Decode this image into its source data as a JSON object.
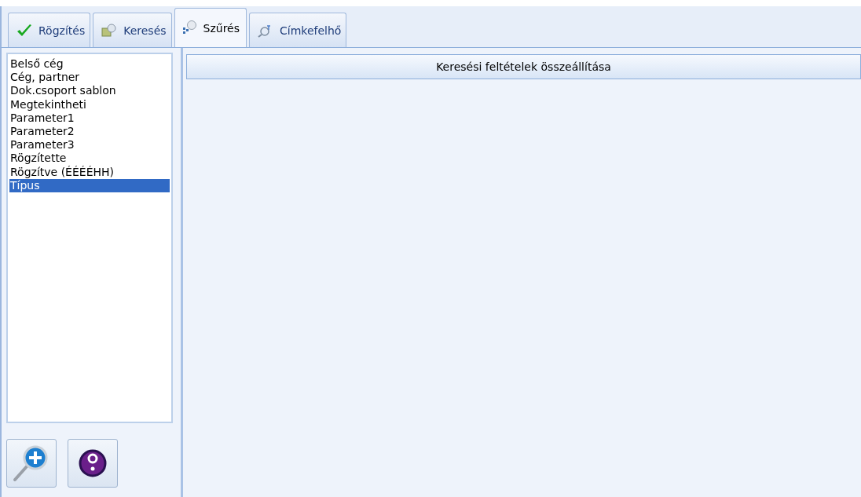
{
  "tabs": [
    {
      "label": "Rögzítés",
      "kind": "check",
      "selected": false
    },
    {
      "label": "Keresés",
      "kind": "search",
      "selected": false
    },
    {
      "label": "Szűrés",
      "kind": "filter",
      "selected": true
    },
    {
      "label": "Címkefelhő",
      "kind": "tags",
      "selected": false
    }
  ],
  "fields": [
    {
      "label": "Belső cég",
      "selected": false
    },
    {
      "label": "Cég, partner",
      "selected": false
    },
    {
      "label": "Dok.csoport sablon",
      "selected": false
    },
    {
      "label": "Megtekintheti",
      "selected": false
    },
    {
      "label": "Parameter1",
      "selected": false
    },
    {
      "label": "Parameter2",
      "selected": false
    },
    {
      "label": "Parameter3",
      "selected": false
    },
    {
      "label": "Rögzítette",
      "selected": false
    },
    {
      "label": "Rögzítve (ÉÉÉÉHH)",
      "selected": false
    },
    {
      "label": "Típus",
      "selected": true
    }
  ],
  "criteria_header": "Keresési feltételek összeállítása"
}
